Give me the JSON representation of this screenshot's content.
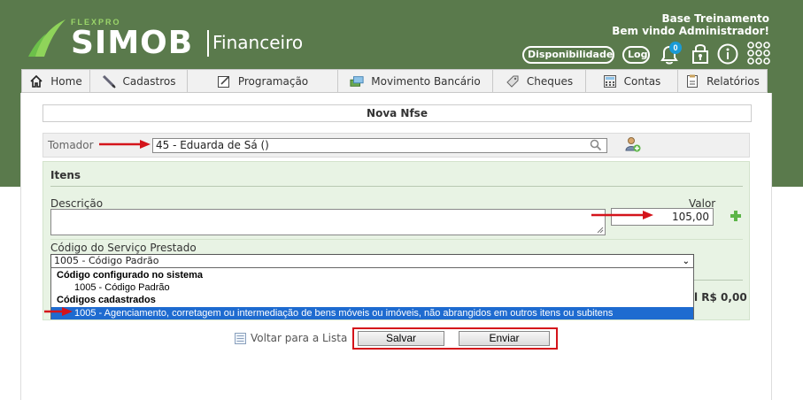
{
  "header": {
    "logo_brand": "FLEXPRO",
    "logo_name": "SIMOB",
    "logo_module": "Financeiro",
    "user_line1": "Base Treinamento",
    "user_line2": "Bem vindo Administrador!",
    "disponibilidade": "Disponibilidade",
    "log": "Log",
    "notification_count": "0"
  },
  "nav": {
    "items": [
      {
        "label": "Home",
        "icon": "home-icon"
      },
      {
        "label": "Cadastros",
        "icon": "pencil-icon"
      },
      {
        "label": "Programação",
        "icon": "edit-icon"
      },
      {
        "label": "Movimento Bancário",
        "icon": "money-icon"
      },
      {
        "label": "Cheques",
        "icon": "tag-icon"
      },
      {
        "label": "Contas",
        "icon": "calculator-icon"
      },
      {
        "label": "Relatórios",
        "icon": "report-icon"
      }
    ]
  },
  "form": {
    "title": "Nova Nfse",
    "tomador_label": "Tomador",
    "tomador_value": "45 - Eduarda de Sá ()",
    "itens_title": "Itens",
    "descricao_label": "Descrição",
    "valor_label": "Valor",
    "valor_value": "105,00",
    "codigo_label": "Código do Serviço Prestado",
    "codigo_selected": "1005 - Código Padrão",
    "total_value": "l R$ 0,00"
  },
  "dropdown": {
    "group1": "Código configurado no sistema",
    "option1": "1005 - Código Padrão",
    "group2": "Códigos cadastrados",
    "option2": "1005 - Agenciamento, corretagem ou intermediação de bens móveis ou imóveis, não abrangidos em outros itens ou subitens"
  },
  "actions": {
    "voltar": "Voltar para a Lista",
    "salvar": "Salvar",
    "enviar": "Enviar"
  },
  "colors": {
    "header_green": "#5a7a4c",
    "panel_green": "#e8f3e4",
    "highlight_red": "#d4141b",
    "selection_blue": "#1e6bd0"
  }
}
